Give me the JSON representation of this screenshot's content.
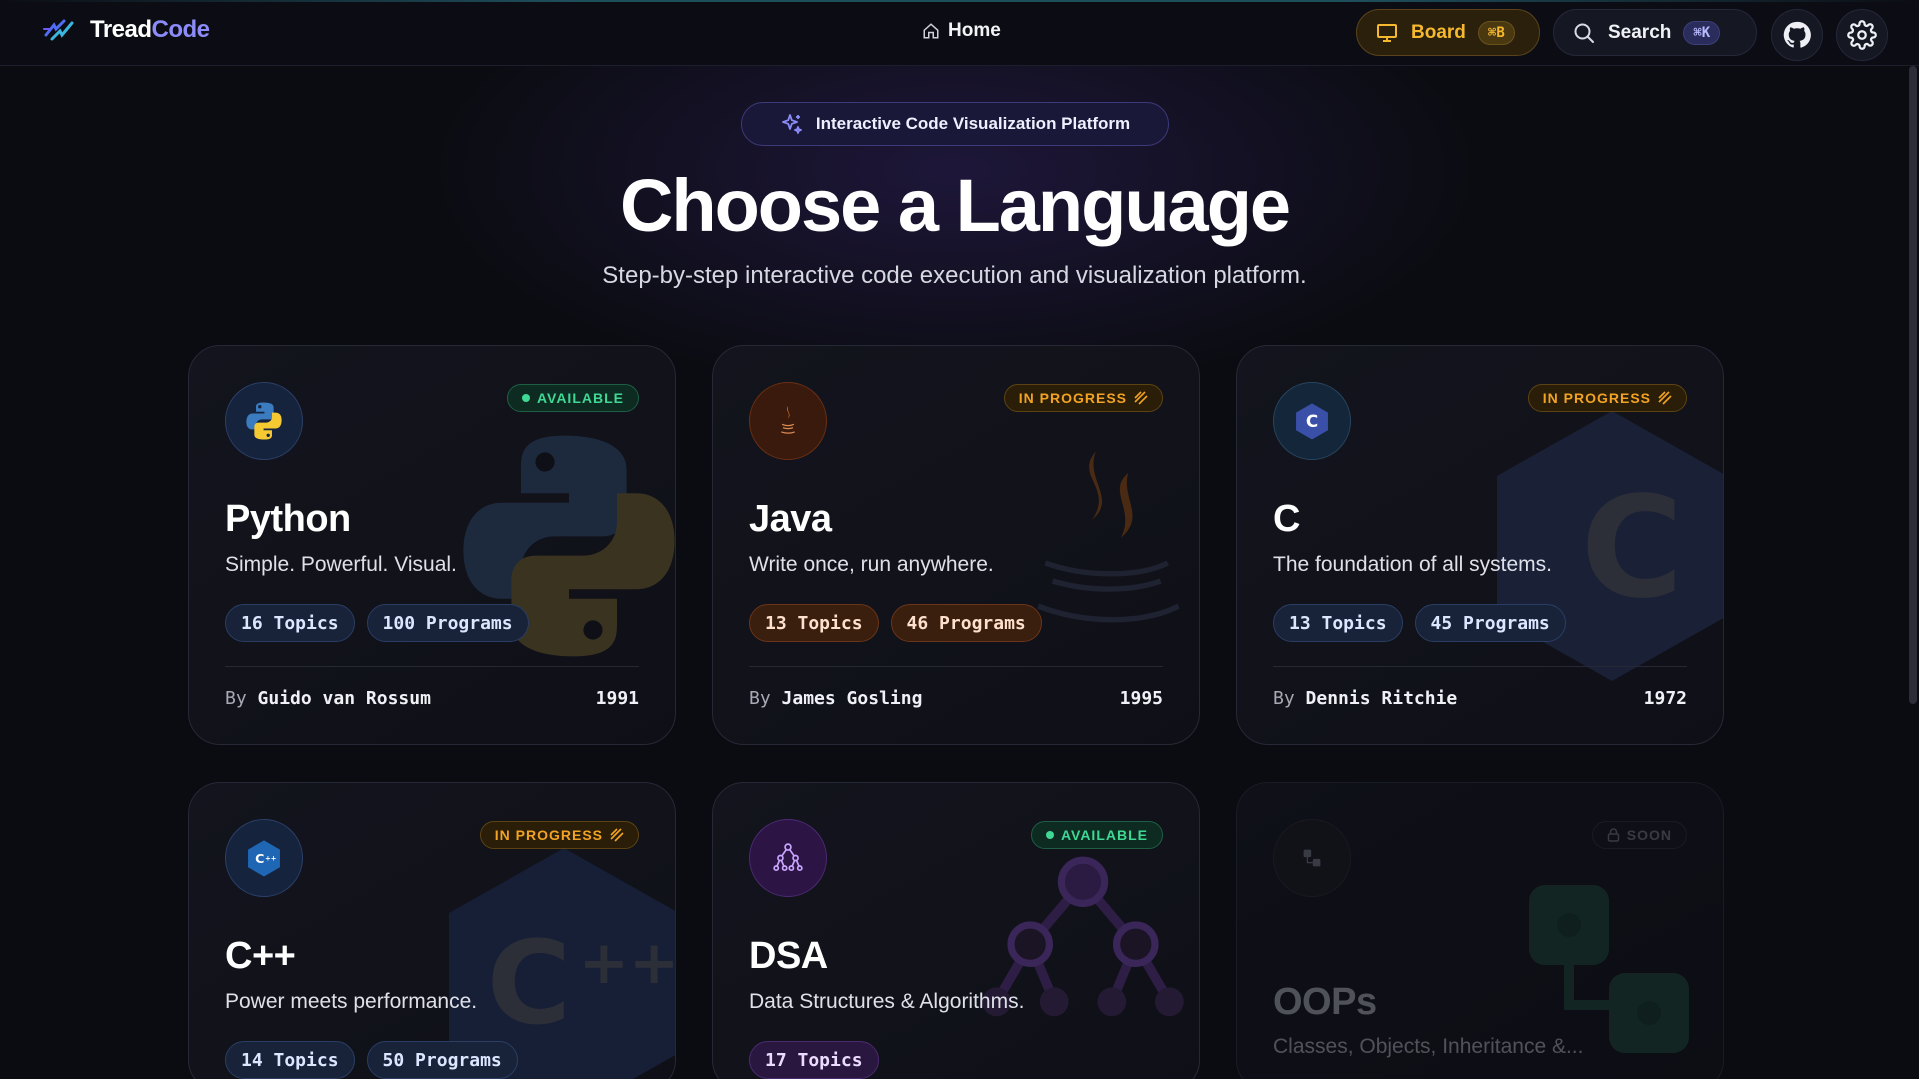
{
  "header": {
    "brand_a": "Tread",
    "brand_b": "Code",
    "home_label": "Home",
    "board_label": "Board",
    "board_shortcut": "⌘B",
    "search_label": "Search",
    "search_shortcut": "⌘K"
  },
  "hero": {
    "badge": "Interactive Code Visualization Platform",
    "title": "Choose a Language",
    "subtitle": "Step-by-step interactive code execution and visualization platform."
  },
  "cards": [
    {
      "name": "Python",
      "tagline": "Simple. Powerful. Visual.",
      "status": "AVAILABLE",
      "topics": "16 Topics",
      "programs": "100 Programs",
      "by": "By",
      "author": "Guido van Rossum",
      "year": "1991",
      "icon": "python-icon"
    },
    {
      "name": "Java",
      "tagline": "Write once, run anywhere.",
      "status": "IN PROGRESS",
      "topics": "13 Topics",
      "programs": "46 Programs",
      "by": "By",
      "author": "James Gosling",
      "year": "1995",
      "icon": "java-icon"
    },
    {
      "name": "C",
      "tagline": "The foundation of all systems.",
      "status": "IN PROGRESS",
      "topics": "13 Topics",
      "programs": "45 Programs",
      "by": "By",
      "author": "Dennis Ritchie",
      "year": "1972",
      "icon": "c-icon"
    },
    {
      "name": "C++",
      "tagline": "Power meets performance.",
      "status": "IN PROGRESS",
      "topics": "14 Topics",
      "programs": "50 Programs",
      "icon": "cpp-icon"
    },
    {
      "name": "DSA",
      "tagline": "Data Structures & Algorithms.",
      "status": "AVAILABLE",
      "topics": "17 Topics",
      "icon": "dsa-icon"
    },
    {
      "name": "OOPs",
      "tagline": "Classes, Objects, Inheritance &...",
      "status": "SOON",
      "icon": "oops-icon"
    }
  ],
  "colors": {
    "accent": "#8b8cf8",
    "available": "#3fd894",
    "in_progress": "#f2a324",
    "board": "#f5b82e"
  }
}
